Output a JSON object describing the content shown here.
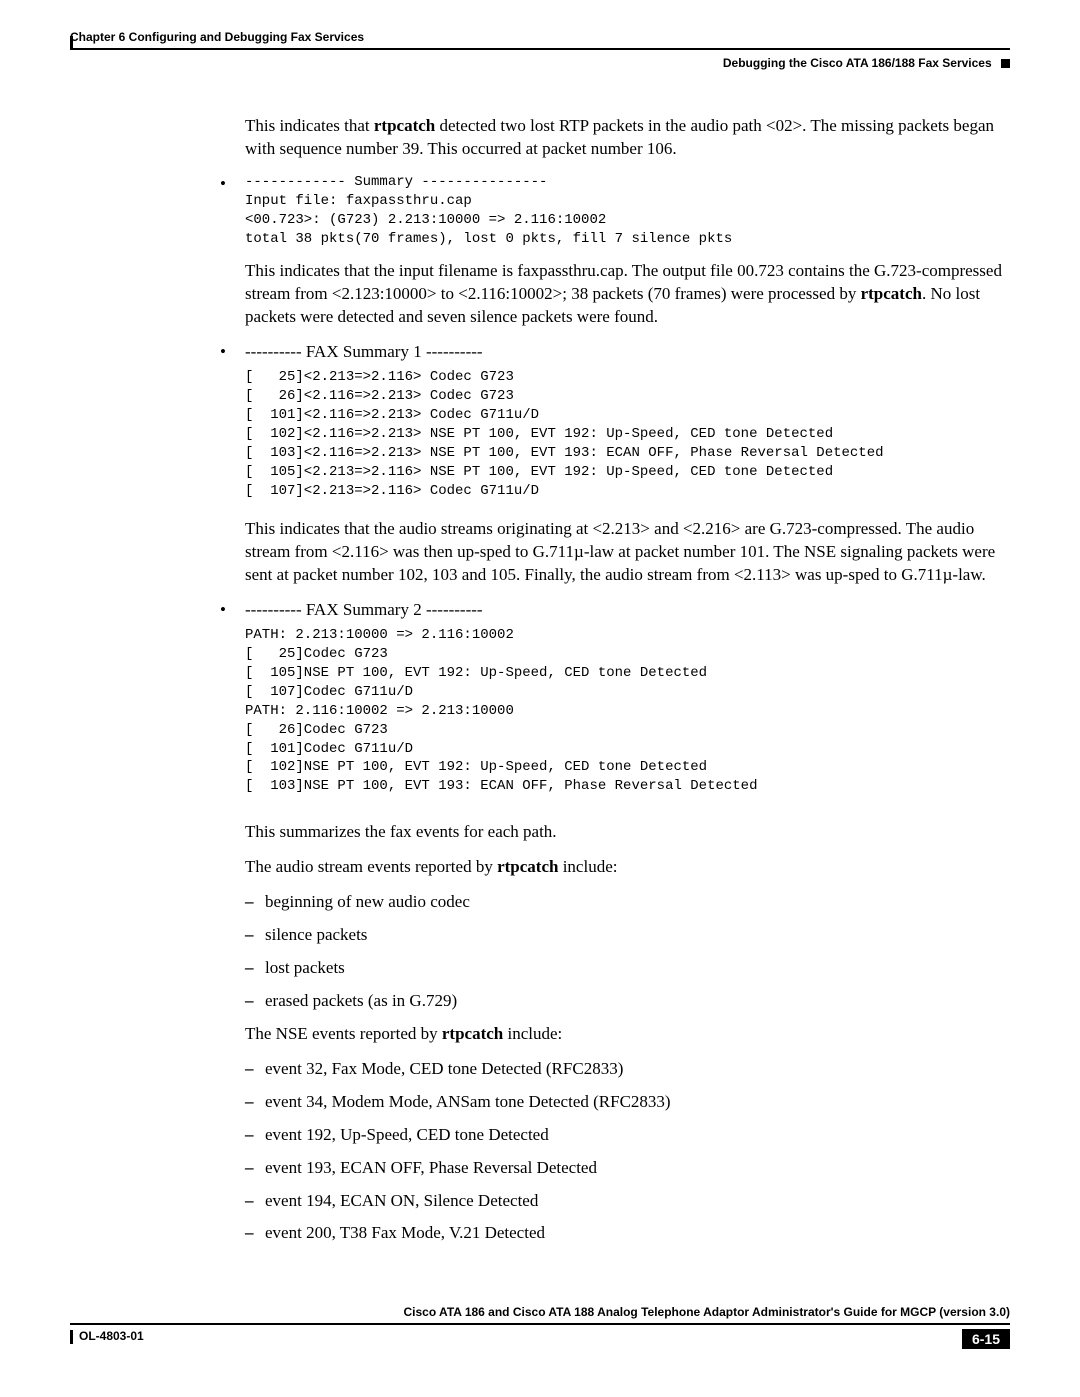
{
  "header": {
    "chapter": "Chapter 6    Configuring and Debugging Fax Services",
    "section": "Debugging the Cisco ATA 186/188 Fax Services"
  },
  "body": {
    "p1_a": "This indicates that ",
    "p1_bold": "rtpcatch",
    "p1_b": " detected two lost RTP packets in the audio path <02>.  The missing packets began with sequence number 39. This occurred at packet number 106.",
    "bullet1_code": "------------ Summary ---------------\nInput file: faxpassthru.cap\n<00.723>: (G723) 2.213:10000 => 2.116:10002\ntotal 38 pkts(70 frames), lost 0 pkts, fill 7 silence pkts",
    "p2_a": "This indicates that the input filename is faxpassthru.cap.  The output file 00.723 contains the G.723-compressed stream from <2.123:10000> to <2.116:10002>; 38 packets (70 frames) were processed by ",
    "p2_bold": "rtpcatch",
    "p2_b": ". No lost packets were detected and seven silence packets were found.",
    "bullet2_label": "---------- FAX Summary 1 ----------",
    "bullet2_code": "[   25]<2.213=>2.116> Codec G723\n[   26]<2.116=>2.213> Codec G723\n[  101]<2.116=>2.213> Codec G711u/D\n[  102]<2.116=>2.213> NSE PT 100, EVT 192: Up-Speed, CED tone Detected\n[  103]<2.116=>2.213> NSE PT 100, EVT 193: ECAN OFF, Phase Reversal Detected\n[  105]<2.213=>2.116> NSE PT 100, EVT 192: Up-Speed, CED tone Detected\n[  107]<2.213=>2.116> Codec G711u/D",
    "p3": "This indicates that the audio streams originating at <2.213> and <2.216> are G.723-compressed. The audio stream from <2.116> was then up-sped to G.711µ-law at packet number 101.  The NSE signaling packets were sent at packet number 102, 103 and 105. Finally, the audio stream from <2.113> was up-sped to G.711µ-law.",
    "bullet3_label": "---------- FAX Summary 2 ----------",
    "bullet3_code": "PATH: 2.213:10000 => 2.116:10002\n[   25]Codec G723\n[  105]NSE PT 100, EVT 192: Up-Speed, CED tone Detected\n[  107]Codec G711u/D\nPATH: 2.116:10002 => 2.213:10000\n[   26]Codec G723\n[  101]Codec G711u/D\n[  102]NSE PT 100, EVT 192: Up-Speed, CED tone Detected\n[  103]NSE PT 100, EVT 193: ECAN OFF, Phase Reversal Detected",
    "p4": "This summarizes the fax events for each path.",
    "p5_a": "The audio stream events reported by ",
    "p5_bold": "rtpcatch",
    "p5_b": " include:",
    "list1": [
      "beginning of new audio codec",
      "silence packets",
      "lost packets",
      "erased packets (as in G.729)"
    ],
    "p6_a": "The NSE events reported by ",
    "p6_bold": "rtpcatch",
    "p6_b": " include:",
    "list2": [
      "event 32, Fax Mode, CED tone Detected (RFC2833)",
      "event 34, Modem Mode, ANSam tone Detected (RFC2833)",
      "event 192, Up-Speed, CED tone Detected",
      "event 193, ECAN OFF, Phase Reversal Detected",
      "event 194, ECAN  ON, Silence Detected",
      "event 200, T38 Fax Mode, V.21 Detected"
    ]
  },
  "footer": {
    "title": "Cisco ATA 186 and Cisco ATA 188 Analog Telephone Adaptor Administrator's Guide for MGCP (version 3.0)",
    "docnum": "OL-4803-01",
    "page": "6-15"
  }
}
